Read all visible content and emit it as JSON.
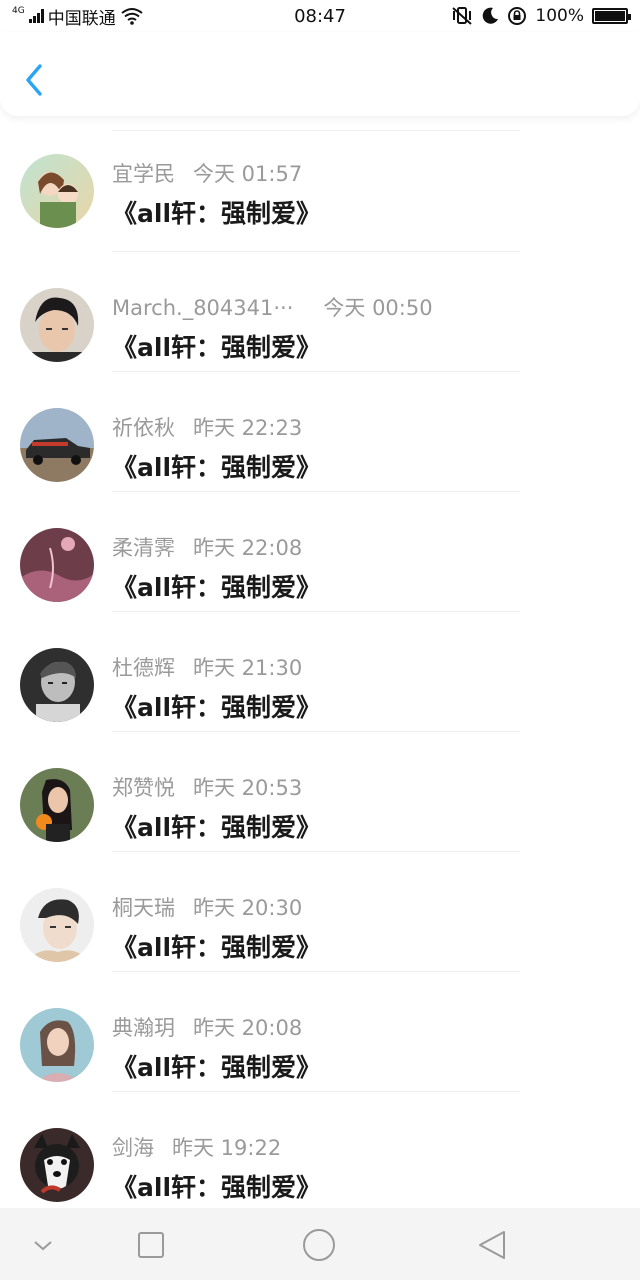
{
  "status_bar": {
    "network_type": "4G",
    "carrier": "中国联通",
    "time": "08:47",
    "battery": "100%",
    "battery_level": 1.0,
    "icons": [
      "signal-icon",
      "wifi-icon",
      "vibrate-off-icon",
      "moon-icon",
      "rotation-lock-icon",
      "battery-icon"
    ]
  },
  "header": {
    "back_icon": "chevron-left-icon",
    "accent_color": "#2aa4f4"
  },
  "items": [
    {
      "name": "宜学民",
      "time": "今天 01:57",
      "title": "《all轩：强制爱》",
      "avatar": "avatar-anime-couple"
    },
    {
      "name": "March._804341···",
      "time": "今天 00:50",
      "title": "《all轩：强制爱》",
      "avatar": "avatar-young-man"
    },
    {
      "name": "祈依秋",
      "time": "昨天 22:23",
      "title": "《all轩：强制爱》",
      "avatar": "avatar-vintage-car"
    },
    {
      "name": "柔清霁",
      "time": "昨天 22:08",
      "title": "《all轩：强制爱》",
      "avatar": "avatar-pink-scene"
    },
    {
      "name": "杜德辉",
      "time": "昨天 21:30",
      "title": "《all轩：强制爱》",
      "avatar": "avatar-bw-child"
    },
    {
      "name": "郑赞悦",
      "time": "昨天 20:53",
      "title": "《all轩：强制爱》",
      "avatar": "avatar-girl-orange"
    },
    {
      "name": "桐天瑞",
      "time": "昨天 20:30",
      "title": "《all轩：强制爱》",
      "avatar": "avatar-boy-white"
    },
    {
      "name": "典瀚玥",
      "time": "昨天 20:08",
      "title": "《all轩：强制爱》",
      "avatar": "avatar-girl-teal"
    },
    {
      "name": "剑海",
      "time": "昨天 19:22",
      "title": "《all轩：强制爱》",
      "avatar": "avatar-husky-dog"
    }
  ],
  "nav_bar": {
    "icons": [
      "chevron-down-icon",
      "square-recent-icon",
      "circle-home-icon",
      "triangle-back-icon"
    ]
  }
}
